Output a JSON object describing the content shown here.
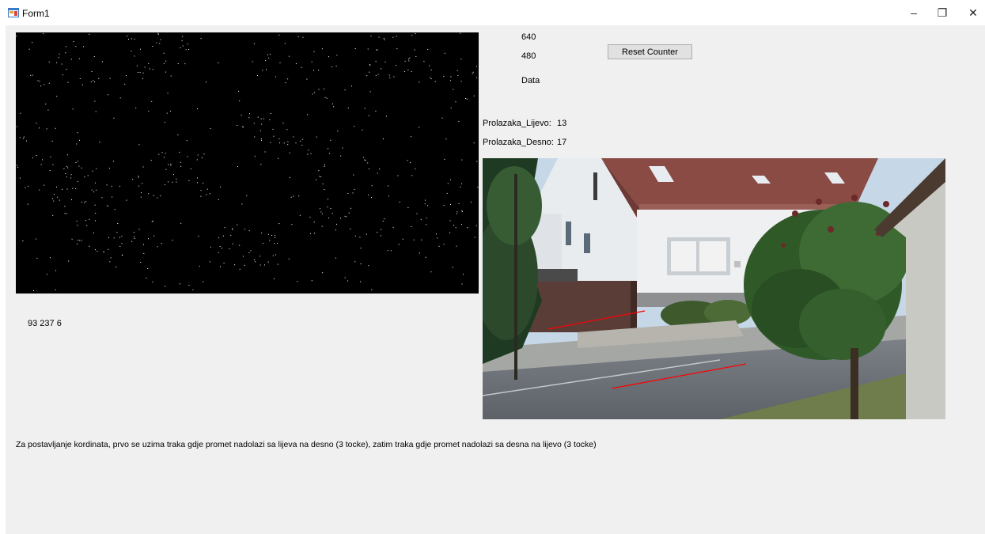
{
  "window": {
    "title": "Form1",
    "minimize_glyph": "–",
    "restore_glyph": "❐",
    "close_glyph": "✕",
    "icon": "winforms-app-icon"
  },
  "labels": {
    "width_value": "640",
    "height_value": "480",
    "data_label": "Data",
    "left_count_label": "Prolazaka_Lijevo:",
    "left_count_value": "13",
    "right_count_label": "Prolazaka_Desno:",
    "right_count_value": "17",
    "coords_text": "93 237 6",
    "instructions": "Za postavljanje kordinata, prvo se uzima traka gdje promet nadolazi sa lijeva na desno (3 tocke), zatim traka gdje promet nadolazi sa desna na lijevo (3 tocke)"
  },
  "buttons": {
    "reset_counter": "Reset Counter"
  },
  "images": {
    "motion_mask": "binary-motion-mask-image",
    "camera_feed": "street-camera-feed-image",
    "lane_line_color": "#ff0000"
  }
}
